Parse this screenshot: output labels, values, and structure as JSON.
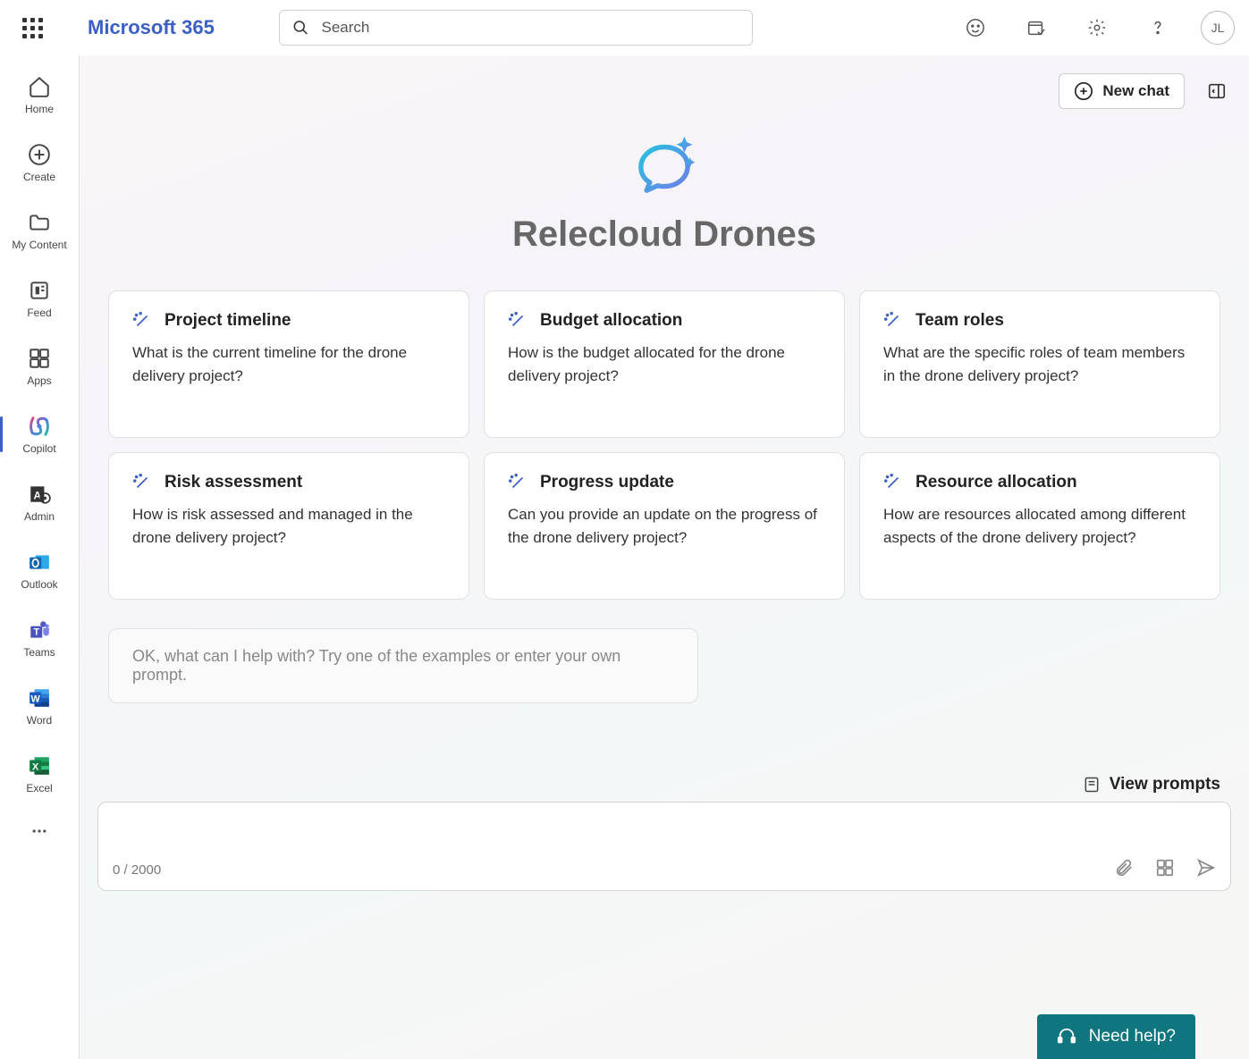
{
  "header": {
    "brand": "Microsoft 365",
    "search_placeholder": "Search",
    "avatar_initials": "JL"
  },
  "sidebar": {
    "items": [
      {
        "label": "Home"
      },
      {
        "label": "Create"
      },
      {
        "label": "My Content"
      },
      {
        "label": "Feed"
      },
      {
        "label": "Apps"
      },
      {
        "label": "Copilot"
      },
      {
        "label": "Admin"
      },
      {
        "label": "Outlook"
      },
      {
        "label": "Teams"
      },
      {
        "label": "Word"
      },
      {
        "label": "Excel"
      }
    ]
  },
  "main": {
    "new_chat_label": "New chat",
    "hero_title": "Relecloud Drones",
    "prompt_hint": "OK, what can I help with? Try one of the examples or enter your own prompt.",
    "view_prompts_label": "View prompts",
    "char_count": "0 / 2000",
    "need_help_label": "Need help?"
  },
  "cards": [
    {
      "title": "Project timeline",
      "body": "What is the current timeline for the drone delivery project?"
    },
    {
      "title": "Budget allocation",
      "body": "How is the budget allocated for the drone delivery project?"
    },
    {
      "title": "Team roles",
      "body": "What are the specific roles of team members in the drone delivery project?"
    },
    {
      "title": "Risk assessment",
      "body": "How is risk assessed and managed in the drone delivery project?"
    },
    {
      "title": "Progress update",
      "body": "Can you provide an update on the progress of the drone delivery project?"
    },
    {
      "title": "Resource allocation",
      "body": "How are resources allocated among different aspects of the drone delivery project?"
    }
  ]
}
